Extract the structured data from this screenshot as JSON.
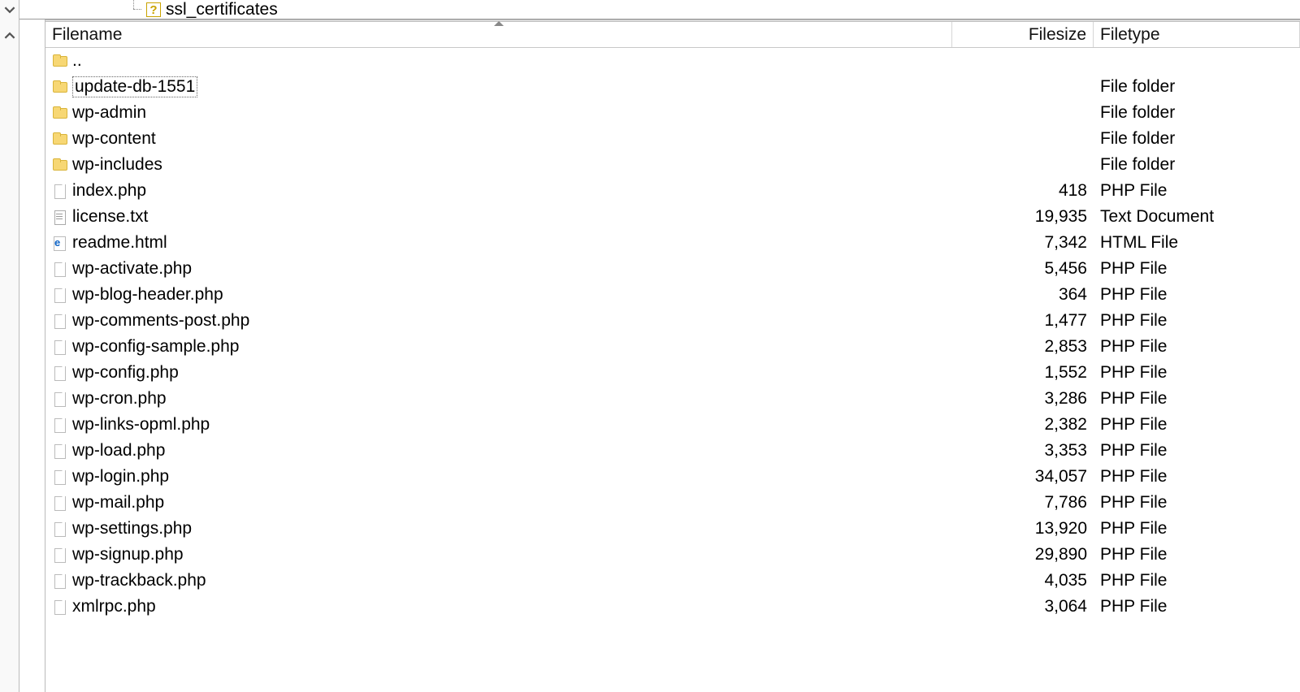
{
  "tree": {
    "node_label": "ssl_certificates"
  },
  "columns": {
    "filename": "Filename",
    "filesize": "Filesize",
    "filetype": "Filetype",
    "sorted_by": "filename",
    "sort_dir": "asc"
  },
  "parent_row": {
    "name": ".."
  },
  "rows": [
    {
      "name": "update-db-1551",
      "size": "",
      "type": "File folder",
      "icon": "folder",
      "selected": true
    },
    {
      "name": "wp-admin",
      "size": "",
      "type": "File folder",
      "icon": "folder"
    },
    {
      "name": "wp-content",
      "size": "",
      "type": "File folder",
      "icon": "folder"
    },
    {
      "name": "wp-includes",
      "size": "",
      "type": "File folder",
      "icon": "folder"
    },
    {
      "name": "index.php",
      "size": "418",
      "type": "PHP File",
      "icon": "file"
    },
    {
      "name": "license.txt",
      "size": "19,935",
      "type": "Text Document",
      "icon": "text"
    },
    {
      "name": "readme.html",
      "size": "7,342",
      "type": "HTML File",
      "icon": "html"
    },
    {
      "name": "wp-activate.php",
      "size": "5,456",
      "type": "PHP File",
      "icon": "file"
    },
    {
      "name": "wp-blog-header.php",
      "size": "364",
      "type": "PHP File",
      "icon": "file"
    },
    {
      "name": "wp-comments-post.php",
      "size": "1,477",
      "type": "PHP File",
      "icon": "file"
    },
    {
      "name": "wp-config-sample.php",
      "size": "2,853",
      "type": "PHP File",
      "icon": "file"
    },
    {
      "name": "wp-config.php",
      "size": "1,552",
      "type": "PHP File",
      "icon": "file"
    },
    {
      "name": "wp-cron.php",
      "size": "3,286",
      "type": "PHP File",
      "icon": "file"
    },
    {
      "name": "wp-links-opml.php",
      "size": "2,382",
      "type": "PHP File",
      "icon": "file"
    },
    {
      "name": "wp-load.php",
      "size": "3,353",
      "type": "PHP File",
      "icon": "file"
    },
    {
      "name": "wp-login.php",
      "size": "34,057",
      "type": "PHP File",
      "icon": "file"
    },
    {
      "name": "wp-mail.php",
      "size": "7,786",
      "type": "PHP File",
      "icon": "file"
    },
    {
      "name": "wp-settings.php",
      "size": "13,920",
      "type": "PHP File",
      "icon": "file"
    },
    {
      "name": "wp-signup.php",
      "size": "29,890",
      "type": "PHP File",
      "icon": "file"
    },
    {
      "name": "wp-trackback.php",
      "size": "4,035",
      "type": "PHP File",
      "icon": "file"
    },
    {
      "name": "xmlrpc.php",
      "size": "3,064",
      "type": "PHP File",
      "icon": "file"
    }
  ]
}
